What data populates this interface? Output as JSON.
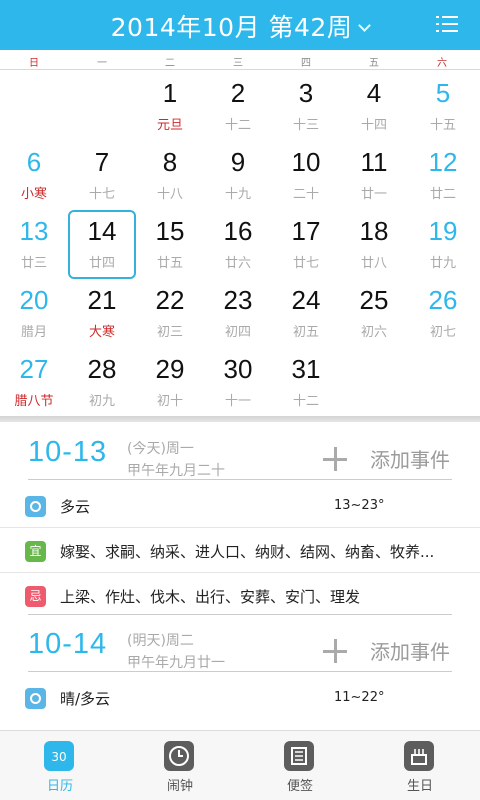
{
  "header": {
    "title": "2014年10月 第42周"
  },
  "weekdays": [
    "日",
    "一",
    "二",
    "三",
    "四",
    "五",
    "六"
  ],
  "calendar": {
    "selected_day": "14",
    "weeks": [
      [
        null,
        {
          "d": "1",
          "l": "元旦",
          "lr": true
        },
        {
          "d": "2",
          "l": "十二"
        },
        {
          "d": "3",
          "l": "十三"
        },
        {
          "d": "4",
          "l": "十四"
        },
        {
          "d": "5",
          "l": "十五"
        }
      ],
      [
        {
          "d": "6",
          "l": "小寒",
          "lr": true
        },
        {
          "d": "7",
          "l": "十七"
        },
        {
          "d": "8",
          "l": "十八"
        },
        {
          "d": "9",
          "l": "十九"
        },
        {
          "d": "10",
          "l": "二十"
        },
        {
          "d": "11",
          "l": "廿一"
        },
        {
          "d": "12",
          "l": "廿二"
        }
      ],
      [
        {
          "d": "13",
          "l": "廿三"
        },
        {
          "d": "14",
          "l": "廿四"
        },
        {
          "d": "15",
          "l": "廿五"
        },
        {
          "d": "16",
          "l": "廿六"
        },
        {
          "d": "17",
          "l": "廿七"
        },
        {
          "d": "18",
          "l": "廿八"
        },
        {
          "d": "19",
          "l": "廿九"
        }
      ],
      [
        {
          "d": "20",
          "l": "腊月"
        },
        {
          "d": "21",
          "l": "大寒",
          "lr": true
        },
        {
          "d": "22",
          "l": "初三"
        },
        {
          "d": "23",
          "l": "初四"
        },
        {
          "d": "24",
          "l": "初五"
        },
        {
          "d": "25",
          "l": "初六"
        },
        {
          "d": "26",
          "l": "初七"
        }
      ],
      [
        {
          "d": "27",
          "l": "腊八节",
          "lr": true
        },
        {
          "d": "28",
          "l": "初九"
        },
        {
          "d": "29",
          "l": "初十"
        },
        {
          "d": "30",
          "l": "十一"
        },
        {
          "d": "31",
          "l": "十二"
        }
      ]
    ]
  },
  "today": {
    "date": "10-13",
    "relative": "(今天)周一",
    "lunar": "甲午年九月二十",
    "add_event": "添加事件",
    "weather": {
      "icon": "sun-icon",
      "text": "多云",
      "temp": "13~23°"
    },
    "good": {
      "label": "宜",
      "text": "嫁娶、求嗣、纳采、进人口、纳财、结网、纳畜、牧养..."
    },
    "bad": {
      "label": "忌",
      "text": "上梁、作灶、伐木、出行、安葬、安门、理发"
    }
  },
  "tomorrow": {
    "date": "10-14",
    "relative": "(明天)周二",
    "lunar": "甲午年九月廿一",
    "add_event": "添加事件",
    "weather": {
      "icon": "sun-icon",
      "text": "晴/多云",
      "temp": "11~22°"
    }
  },
  "tabbar": {
    "calendar_icon_day": "30",
    "items": [
      {
        "label": "日历",
        "icon": "calendar-icon"
      },
      {
        "label": "闹钟",
        "icon": "clock-icon"
      },
      {
        "label": "便签",
        "icon": "note-icon"
      },
      {
        "label": "生日",
        "icon": "cake-icon"
      }
    ]
  },
  "colors": {
    "accent": "#2db7ea",
    "red": "#cc2a2a",
    "good": "#66b84a",
    "bad": "#ee5a6e"
  }
}
